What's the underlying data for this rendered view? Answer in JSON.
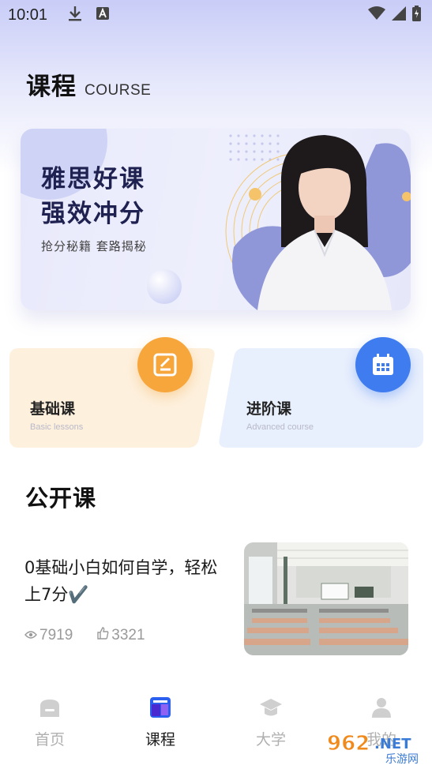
{
  "status_bar": {
    "time": "10:01"
  },
  "header": {
    "title": "课程",
    "subtitle": "COURSE"
  },
  "banner": {
    "line1": "雅思好课",
    "line2": "强效冲分",
    "tagline": "抢分秘籍  套路揭秘"
  },
  "lesson_cards": [
    {
      "title": "基础课",
      "subtitle": "Basic lessons",
      "icon": "edit-book-icon",
      "color": "#f7a63c"
    },
    {
      "title": "进阶课",
      "subtitle": "Advanced course",
      "icon": "calendar-icon",
      "color": "#3e7cf0"
    }
  ],
  "public_section": {
    "title": "公开课"
  },
  "courses": [
    {
      "title": "0基础小白如何自学，轻松上7分✔️",
      "views": "7919",
      "likes": "3321"
    }
  ],
  "tab_bar": {
    "items": [
      {
        "label": "首页",
        "icon": "home-icon",
        "active": false
      },
      {
        "label": "课程",
        "icon": "course-icon",
        "active": true
      },
      {
        "label": "大学",
        "icon": "graduation-cap-icon",
        "active": false
      },
      {
        "label": "我的",
        "icon": "user-icon",
        "active": false
      }
    ]
  },
  "watermark": {
    "brand": "962.NET",
    "sub": "乐游网"
  },
  "colors": {
    "accent_orange": "#f7a63c",
    "accent_blue": "#3e7cf0",
    "banner_text": "#1f2150"
  }
}
